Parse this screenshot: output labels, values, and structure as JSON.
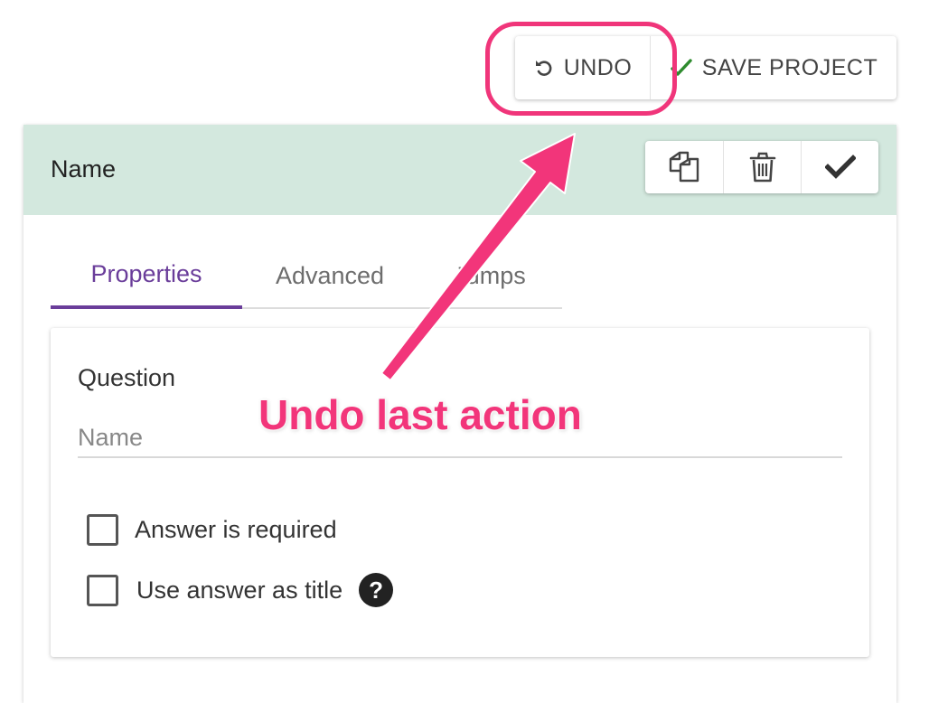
{
  "toolbar": {
    "undo_label": "UNDO",
    "save_label": "SAVE PROJECT"
  },
  "card": {
    "title": "Name",
    "header_color": "#d3e8de",
    "actions": [
      "duplicate-icon",
      "trash-icon",
      "check-icon"
    ]
  },
  "tabs": [
    {
      "label": "Properties",
      "active": true
    },
    {
      "label": "Advanced",
      "active": false
    },
    {
      "label": "Jumps",
      "active": false
    }
  ],
  "form": {
    "question_label": "Question",
    "question_placeholder": "Name",
    "question_value": "",
    "checkboxes": [
      {
        "label": "Answer is required",
        "checked": false
      },
      {
        "label": "Use answer as title",
        "checked": false
      }
    ],
    "help_glyph": "?"
  },
  "annotation": {
    "text": "Undo last action",
    "color": "#f2357a"
  },
  "colors": {
    "accent": "#6a3d9a",
    "save_check": "#2e8b2e"
  }
}
